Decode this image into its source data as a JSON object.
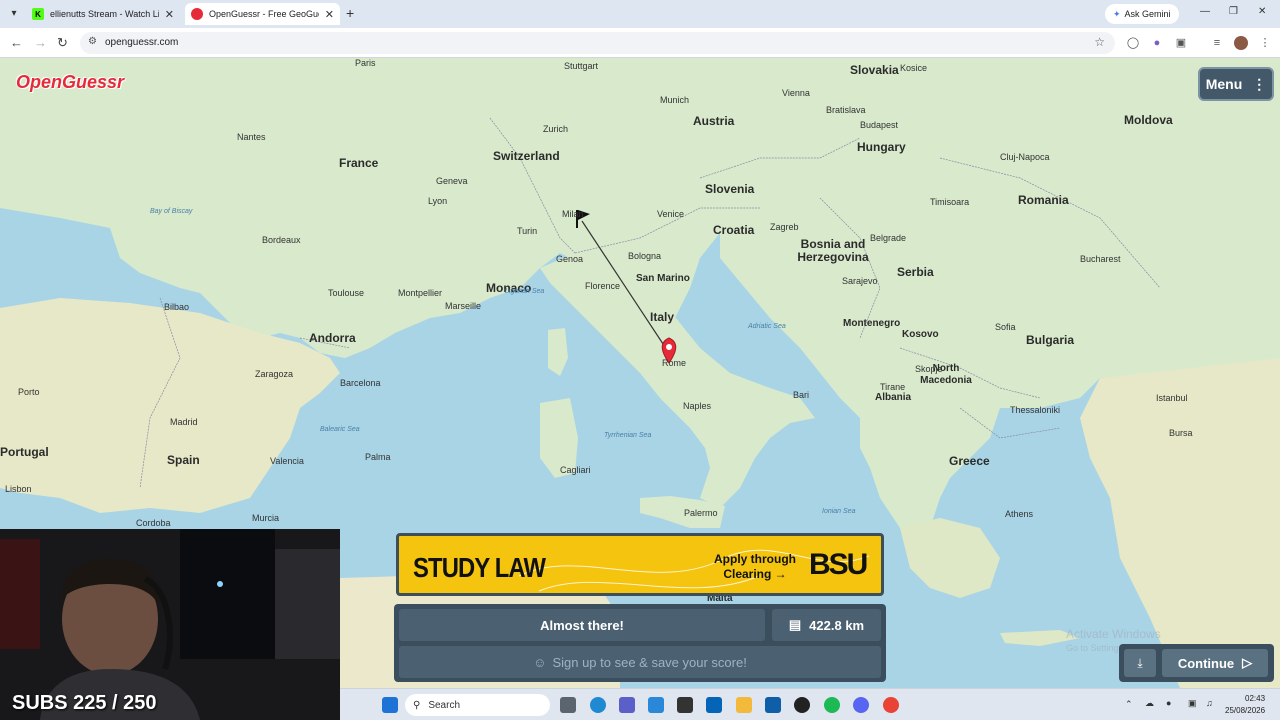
{
  "browser": {
    "tabs": [
      {
        "title": "ellienutts Stream - Watch Live o",
        "favicon_color": "#53fc18"
      },
      {
        "title": "OpenGuessr - Free GeoGuessr A",
        "favicon_color": "#e52b3a",
        "active": true
      }
    ],
    "ask_gemini": "Ask Gemini",
    "url": "openguessr.com"
  },
  "game": {
    "logo": "OpenGuessr",
    "menu_label": "Menu",
    "ad": {
      "headline": "STUDY LAW",
      "cta": "Apply through Clearing →",
      "brand": "BSU"
    },
    "result_message": "Almost there!",
    "distance": "422.8 km",
    "signup": "Sign up to see & save your score!",
    "continue_label": "Continue"
  },
  "map": {
    "countries": [
      "France",
      "Switzerland",
      "Austria",
      "Slovakia",
      "Hungary",
      "Moldova",
      "Romania",
      "Slovenia",
      "Croatia",
      "Bosnia and Herzegovina",
      "Serbia",
      "San Marino",
      "Italy",
      "Monaco",
      "Andorra",
      "Spain",
      "Portugal",
      "Montenegro",
      "Kosovo",
      "Bulgaria",
      "North Macedonia",
      "Albania",
      "Greece",
      "Malta"
    ],
    "cities": [
      "Paris",
      "Stuttgart",
      "Vienna",
      "Bratislava",
      "Budapest",
      "Munich",
      "Zurich",
      "Lyon",
      "Geneva",
      "Milan",
      "Turin",
      "Venice",
      "Bologna",
      "Genoa",
      "Florence",
      "Zagreb",
      "Sarajevo",
      "Belgrade",
      "Bucharest",
      "Timisoara",
      "Cluj-Napoca",
      "Rome",
      "Naples",
      "Bari",
      "Palermo",
      "Cagliari",
      "Barcelona",
      "Madrid",
      "Valencia",
      "Zaragoza",
      "Porto",
      "Lisbon",
      "Bordeaux",
      "Toulouse",
      "Marseille",
      "Montpellier",
      "Nantes",
      "Bilbao",
      "Sofia",
      "Tirane",
      "Skopje",
      "Thessaloniki",
      "Athens",
      "Istanbul",
      "Bursa",
      "Palma",
      "Murcia",
      "Cordoba",
      "Kosice"
    ],
    "seas": [
      "Bay of Biscay",
      "Tyrrhenian Sea",
      "Adriatic Sea",
      "Balearic Sea",
      "Ionian Sea",
      "Ligurian Sea"
    ]
  },
  "stream": {
    "subs": "SUBS 225 / 250"
  },
  "windows": {
    "activate_title": "Activate Windows",
    "activate_sub": "Go to Settings to activate Windows.",
    "search_label": "Search",
    "time": "02:43",
    "date": "25/08/2026"
  }
}
